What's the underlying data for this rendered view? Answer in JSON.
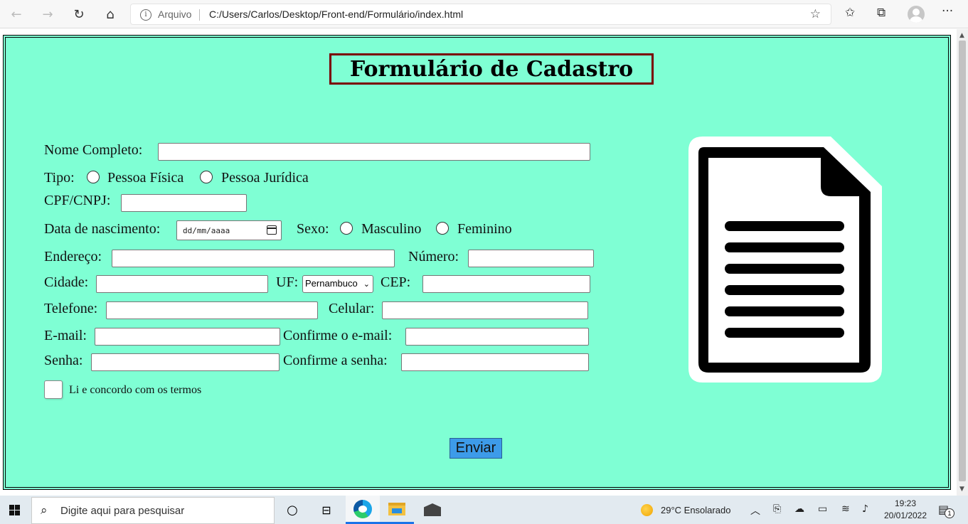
{
  "browser": {
    "address_prefix": "Arquivo",
    "url": "C:/Users/Carlos/Desktop/Front-end/Formulário/index.html"
  },
  "form": {
    "title": "Formulário de Cadastro",
    "labels": {
      "nome": "Nome Completo:",
      "tipo": "Tipo:",
      "pessoa_fisica": "Pessoa Física",
      "pessoa_juridica": "Pessoa Jurídica",
      "cpf_cnpj": "CPF/CNPJ:",
      "nascimento": "Data de nascimento:",
      "sexo": "Sexo:",
      "masculino": "Masculino",
      "feminino": "Feminino",
      "endereco": "Endereço:",
      "numero": "Número:",
      "cidade": "Cidade:",
      "uf": "UF:",
      "cep": "CEP:",
      "telefone": "Telefone:",
      "celular": "Celular:",
      "email": "E-mail:",
      "confirme_email": "Confirme o e-mail:",
      "senha": "Senha:",
      "confirme_senha": "Confirme a senha:",
      "termos": "Li e concordo com os termos"
    },
    "date_placeholder": "dd/mm/aaaa",
    "uf_selected": "Pernambuco",
    "submit_label": "Enviar"
  },
  "taskbar": {
    "search_placeholder": "Digite aqui para pesquisar",
    "weather": "29°C  Ensolarado",
    "time": "19:23",
    "date": "20/01/2022",
    "notifications": "1"
  }
}
